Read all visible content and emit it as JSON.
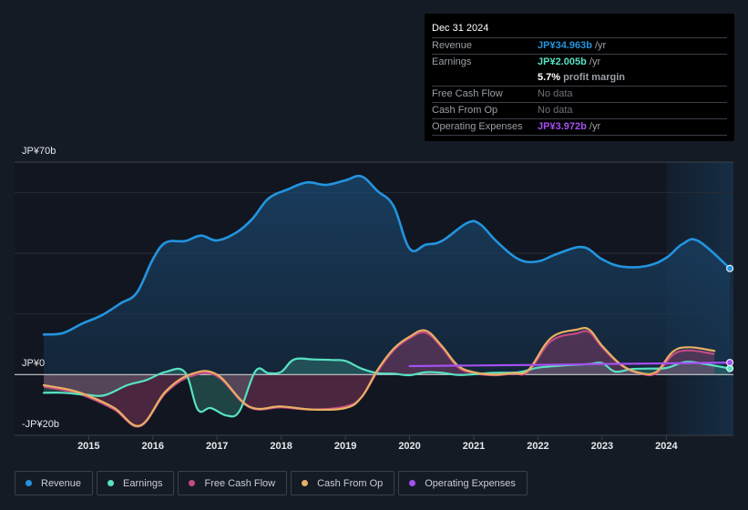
{
  "tooltip": {
    "date": "Dec 31 2024",
    "rows": [
      {
        "label": "Revenue",
        "value": "JP¥34.963b",
        "suffix": " /yr",
        "color": "#2394df"
      },
      {
        "label": "Earnings",
        "value": "JP¥2.005b",
        "suffix": " /yr",
        "color": "#58e2c2"
      },
      {
        "label": "",
        "value": "5.7%",
        "suffix": " profit margin",
        "color": "#ffffff"
      },
      {
        "label": "Free Cash Flow",
        "value": "No data",
        "suffix": "",
        "color": "#6c7077"
      },
      {
        "label": "Cash From Op",
        "value": "No data",
        "suffix": "",
        "color": "#6c7077"
      },
      {
        "label": "Operating Expenses",
        "value": "JP¥3.972b",
        "suffix": " /yr",
        "color": "#a450ef"
      }
    ]
  },
  "legend": [
    {
      "label": "Revenue",
      "color": "#2394df"
    },
    {
      "label": "Earnings",
      "color": "#58e2c2"
    },
    {
      "label": "Free Cash Flow",
      "color": "#c44b84"
    },
    {
      "label": "Cash From Op",
      "color": "#e8b063"
    },
    {
      "label": "Operating Expenses",
      "color": "#a450ef"
    }
  ],
  "chart_data": {
    "type": "line",
    "title": "",
    "xlabel": "",
    "ylabel": "",
    "y_unit": "JP¥ billions",
    "ylim": [
      -20,
      70
    ],
    "xlim": [
      2014.3,
      2024.99
    ],
    "y_tick_labels": [
      {
        "value": 70,
        "label": "JP¥70b"
      },
      {
        "value": 0,
        "label": "JP¥0"
      },
      {
        "value": -20,
        "label": "-JP¥20b"
      }
    ],
    "gridlines": [
      70,
      60,
      40,
      20,
      0,
      -20
    ],
    "x_tick_labels": [
      "2015",
      "2016",
      "2017",
      "2018",
      "2019",
      "2020",
      "2021",
      "2022",
      "2023",
      "2024"
    ],
    "x_ticks": [
      2015,
      2016,
      2017,
      2018,
      2019,
      2020,
      2021,
      2022,
      2023,
      2024
    ],
    "highlight_start": 2024.0,
    "legend_position": "bottom",
    "series": [
      {
        "name": "Revenue",
        "color": "#2394df",
        "fill": true,
        "x": [
          2014.3,
          2014.6,
          2014.9,
          2015.2,
          2015.5,
          2015.75,
          2016.0,
          2016.2,
          2016.5,
          2016.75,
          2017.0,
          2017.3,
          2017.55,
          2017.8,
          2018.1,
          2018.4,
          2018.7,
          2019.0,
          2019.25,
          2019.5,
          2019.75,
          2020.0,
          2020.25,
          2020.5,
          2020.9,
          2021.1,
          2021.35,
          2021.7,
          2022.0,
          2022.3,
          2022.7,
          2023.0,
          2023.3,
          2023.7,
          2024.0,
          2024.25,
          2024.5,
          2024.99
        ],
        "values": [
          13.2,
          13.7,
          16.8,
          19.5,
          23.5,
          27.0,
          38.0,
          43.5,
          44.0,
          45.8,
          44.2,
          46.8,
          51.3,
          58.0,
          61.0,
          63.3,
          62.5,
          64.0,
          65.3,
          60.5,
          55.5,
          41.5,
          42.8,
          44.0,
          50.0,
          49.5,
          44.0,
          38.0,
          37.3,
          39.8,
          42.0,
          38.0,
          35.6,
          35.8,
          38.5,
          43.0,
          44.0,
          34.963
        ]
      },
      {
        "name": "Earnings",
        "color": "#58e2c2",
        "fill": true,
        "x": [
          2014.3,
          2014.6,
          2014.95,
          2015.25,
          2015.6,
          2015.9,
          2016.2,
          2016.5,
          2016.7,
          2016.9,
          2017.15,
          2017.35,
          2017.6,
          2017.8,
          2018.0,
          2018.2,
          2018.5,
          2018.8,
          2019.0,
          2019.25,
          2019.5,
          2019.75,
          2020.0,
          2020.25,
          2020.5,
          2020.75,
          2021.0,
          2021.3,
          2021.7,
          2022.0,
          2022.4,
          2022.8,
          2023.0,
          2023.2,
          2023.45,
          2023.7,
          2024.0,
          2024.3,
          2024.6,
          2024.99
        ],
        "values": [
          -6.0,
          -6.0,
          -6.6,
          -6.8,
          -3.5,
          -1.8,
          0.9,
          0.8,
          -11.5,
          -11.0,
          -13.5,
          -12.0,
          1.2,
          0.5,
          0.9,
          5.0,
          5.0,
          4.8,
          4.5,
          2.0,
          0.5,
          0.3,
          -0.2,
          0.8,
          0.6,
          -0.1,
          0.1,
          0.6,
          0.8,
          2.3,
          3.0,
          3.5,
          3.8,
          1.0,
          1.8,
          2.0,
          2.2,
          4.2,
          3.5,
          2.005
        ]
      },
      {
        "name": "Free Cash Flow",
        "color": "#c44b84",
        "fill": true,
        "x": [
          2014.3,
          2014.7,
          2015.0,
          2015.4,
          2015.8,
          2016.2,
          2016.6,
          2017.0,
          2017.5,
          2018.0,
          2018.5,
          2019.0,
          2019.25,
          2019.5,
          2019.75,
          2020.0,
          2020.25,
          2020.5,
          2020.75,
          2021.0,
          2021.3,
          2021.6,
          2021.85,
          2022.2,
          2022.6,
          2022.8,
          2023.0,
          2023.3,
          2023.6,
          2023.85,
          2024.1,
          2024.35,
          2024.75
        ],
        "values": [
          -4.0,
          -5.5,
          -7.5,
          -11.5,
          -17.0,
          -6.0,
          -0.5,
          -0.5,
          -10.7,
          -10.8,
          -11.5,
          -10.5,
          -7.5,
          1.0,
          8.0,
          12.0,
          13.8,
          9.0,
          2.5,
          0.5,
          -0.2,
          0.3,
          1.0,
          11.0,
          13.6,
          14.0,
          9.0,
          3.0,
          0.3,
          0.5,
          6.5,
          8.0,
          6.8
        ]
      },
      {
        "name": "Cash From Op",
        "color": "#e8b063",
        "fill": false,
        "x": [
          2014.3,
          2014.7,
          2015.0,
          2015.4,
          2015.8,
          2016.2,
          2016.6,
          2017.0,
          2017.5,
          2018.0,
          2018.5,
          2019.0,
          2019.25,
          2019.5,
          2019.75,
          2020.0,
          2020.25,
          2020.5,
          2020.75,
          2021.0,
          2021.3,
          2021.6,
          2021.85,
          2022.2,
          2022.6,
          2022.8,
          2023.0,
          2023.3,
          2023.6,
          2023.85,
          2024.1,
          2024.35,
          2024.75
        ],
        "values": [
          -3.5,
          -5.0,
          -7.0,
          -11.0,
          -16.8,
          -5.5,
          0.2,
          0.0,
          -10.5,
          -10.5,
          -11.5,
          -11.0,
          -7.5,
          1.5,
          8.5,
          12.5,
          14.5,
          9.5,
          3.0,
          0.8,
          0.0,
          0.5,
          1.5,
          12.0,
          14.8,
          14.8,
          9.5,
          3.2,
          0.5,
          1.0,
          7.5,
          9.0,
          7.8
        ]
      },
      {
        "name": "Operating Expenses",
        "color": "#a450ef",
        "fill": false,
        "x": [
          2020.0,
          2021.0,
          2022.0,
          2023.0,
          2024.0,
          2024.99
        ],
        "values": [
          2.8,
          3.0,
          3.2,
          3.5,
          3.7,
          3.972
        ]
      }
    ]
  }
}
